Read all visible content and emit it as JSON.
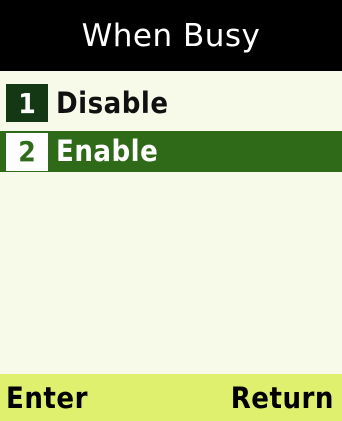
{
  "title": "When Busy",
  "menu": {
    "items": [
      {
        "number": "1",
        "label": "Disable",
        "selected": false
      },
      {
        "number": "2",
        "label": "Enable",
        "selected": true
      }
    ]
  },
  "softkeys": {
    "left": "Enter",
    "right": "Return"
  },
  "colors": {
    "title_bar": "#000000",
    "content_bg": "#f8fae9",
    "selected_row": "#2f6a18",
    "softkey_bar": "#dff06f"
  }
}
